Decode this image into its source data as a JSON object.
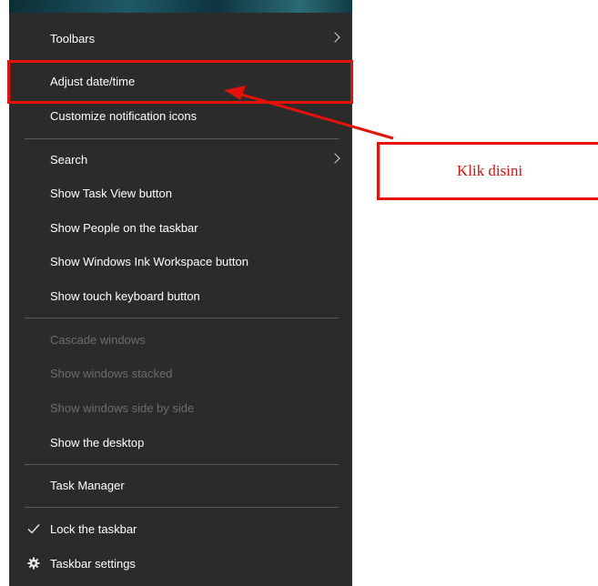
{
  "menu": {
    "items": [
      {
        "label": "Toolbars",
        "submenu": true,
        "enabled": true
      },
      {
        "label": "Adjust date/time",
        "enabled": true
      },
      {
        "label": "Customize notification icons",
        "enabled": true
      },
      {
        "label": "Search",
        "submenu": true,
        "enabled": true
      },
      {
        "label": "Show Task View button",
        "enabled": true
      },
      {
        "label": "Show People on the taskbar",
        "enabled": true
      },
      {
        "label": "Show Windows Ink Workspace button",
        "enabled": true
      },
      {
        "label": "Show touch keyboard button",
        "enabled": true
      },
      {
        "label": "Cascade windows",
        "enabled": false
      },
      {
        "label": "Show windows stacked",
        "enabled": false
      },
      {
        "label": "Show windows side by side",
        "enabled": false
      },
      {
        "label": "Show the desktop",
        "enabled": true
      },
      {
        "label": "Task Manager",
        "enabled": true
      },
      {
        "label": "Lock the taskbar",
        "enabled": true,
        "checked": true,
        "icon": "checkmark-icon"
      },
      {
        "label": "Taskbar settings",
        "enabled": true,
        "icon": "gear-icon"
      }
    ]
  },
  "annotation": {
    "callout_text": "Klik disini",
    "color": "#e3120b"
  },
  "colors": {
    "menu_bg": "#2b2b2b",
    "menu_text": "#ffffff",
    "disabled_text": "#6d6d6d",
    "separator": "#5a5a5a"
  }
}
